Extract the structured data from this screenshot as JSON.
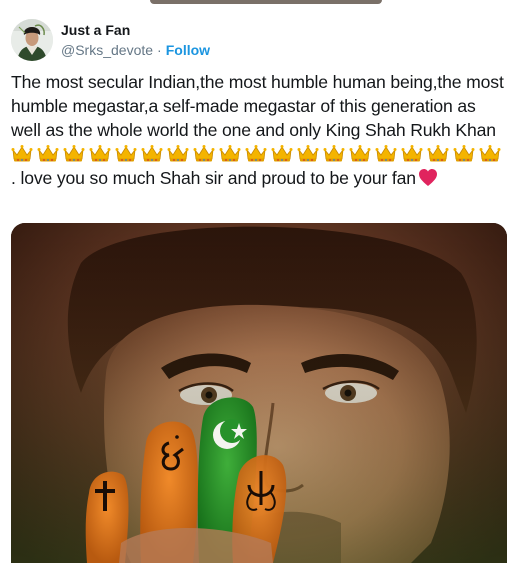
{
  "tweet": {
    "author": {
      "display_name": "Just a Fan",
      "handle": "@Srks_devote",
      "separator": "·",
      "follow_label": "Follow"
    },
    "text_before_emoji": "The most secular Indian,the most humble human being,the most humble megastar,a self-made megastar of this generation as well as the whole world the one and only King Shah Rukh Khan",
    "text_after_emoji": ". love you so much Shah sir and proud to be your fan",
    "crown_emoji_count": 19,
    "icons": {
      "crown": "crown-emoji",
      "heart": "red-heart-emoji",
      "avatar": "profile-avatar"
    },
    "media": {
      "description_icon": "photo",
      "finger_symbols": [
        "cross-icon",
        "om-icon",
        "star-and-crescent-icon",
        "khanda-icon"
      ]
    }
  },
  "colors": {
    "text": "#14171a",
    "secondary": "#657786",
    "link": "#1b95e0",
    "heart": "#e0245e",
    "crown": "#f4b400"
  }
}
